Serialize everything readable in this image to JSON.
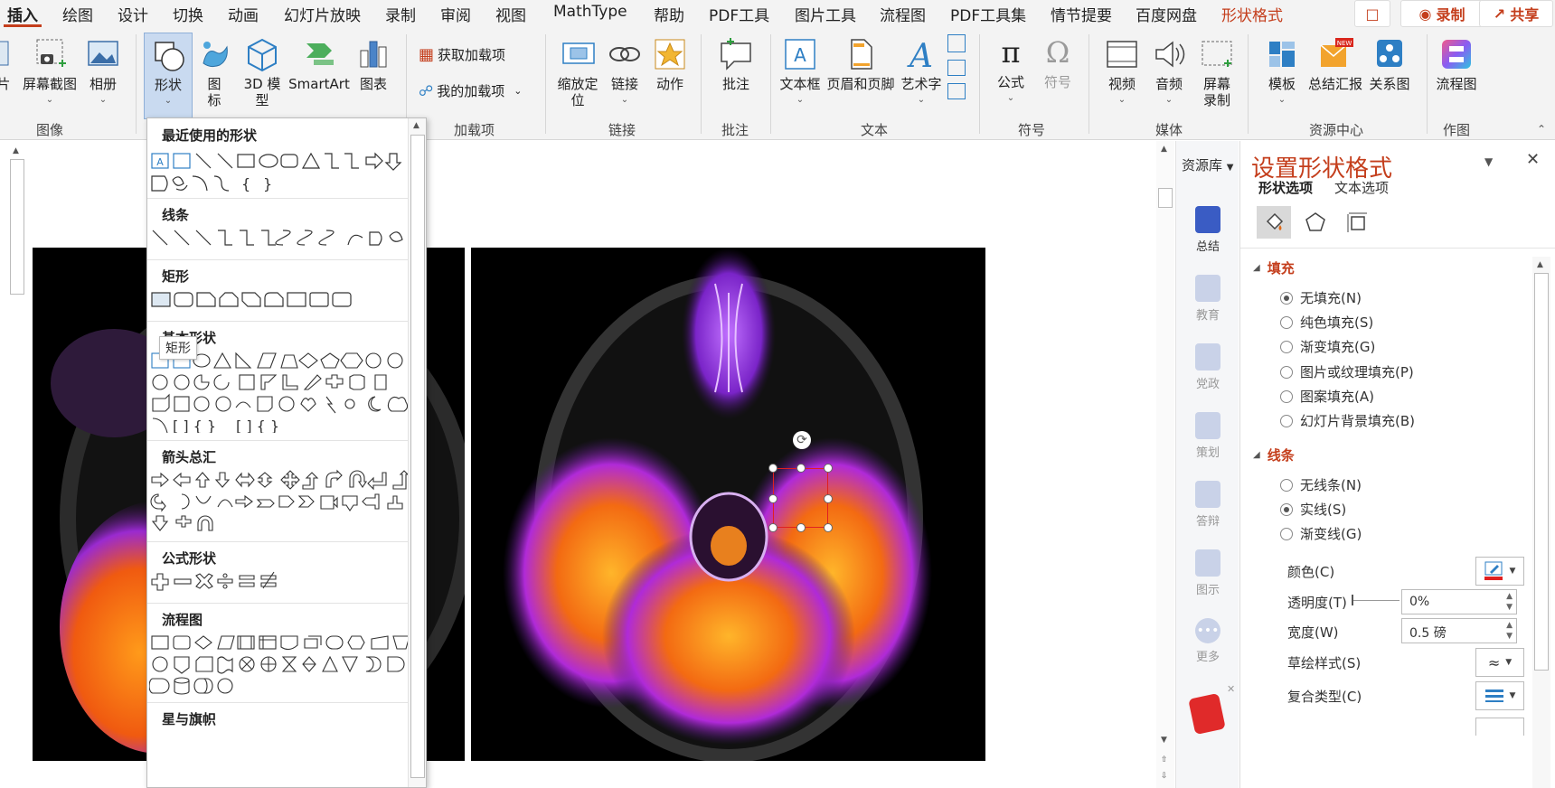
{
  "tabs": [
    "插入",
    "绘图",
    "设计",
    "切换",
    "动画",
    "幻灯片放映",
    "录制",
    "审阅",
    "视图",
    "MathType",
    "帮助",
    "PDF工具",
    "图片工具",
    "流程图",
    "PDF工具集",
    "情节提要",
    "百度网盘",
    "形状格式"
  ],
  "topbar": {
    "record_label": "录制",
    "share_label": "共享"
  },
  "ribbon": {
    "image_group": {
      "label": "图像",
      "screenshot": "屏幕截图",
      "album": "相册",
      "partial": "片"
    },
    "illus": {
      "shapes": "形状",
      "icons": "图标",
      "model3d": "3D 模型",
      "smartart": "SmartArt",
      "chart": "图表"
    },
    "addins": {
      "label": "加载项",
      "get": "获取加载项",
      "mine": "我的加载项"
    },
    "links": {
      "label": "链接",
      "zoom": "缩放定位",
      "link": "链接",
      "action": "动作"
    },
    "comments": {
      "label": "批注",
      "comment": "批注"
    },
    "text": {
      "label": "文本",
      "textbox": "文本框",
      "headerfooter": "页眉和页脚",
      "wordart": "艺术字"
    },
    "symbols": {
      "label": "符号",
      "equation": "公式",
      "symbol": "符号"
    },
    "media": {
      "label": "媒体",
      "video": "视频",
      "audio": "音频",
      "screenrec": "屏幕录制"
    },
    "resource": {
      "label": "资源中心",
      "template": "模板",
      "summary": "总结汇报",
      "relation": "关系图",
      "new_badge": "NEW"
    },
    "draw": {
      "label": "作图",
      "flowchart": "流程图"
    }
  },
  "shapes_menu": {
    "sections": [
      "最近使用的形状",
      "线条",
      "矩形",
      "基本形状",
      "箭头总汇",
      "公式形状",
      "流程图",
      "星与旗帜"
    ],
    "tooltip": "矩形"
  },
  "resbar": {
    "title": "资源库",
    "items": [
      "总结",
      "教育",
      "党政",
      "策划",
      "答辩",
      "图示",
      "更多"
    ]
  },
  "pane": {
    "title": "设置形状格式",
    "tab_shape": "形状选项",
    "tab_text": "文本选项",
    "fill": {
      "header": "填充",
      "options": [
        "无填充(N)",
        "纯色填充(S)",
        "渐变填充(G)",
        "图片或纹理填充(P)",
        "图案填充(A)",
        "幻灯片背景填充(B)"
      ],
      "selected": 0
    },
    "line": {
      "header": "线条",
      "options": [
        "无线条(N)",
        "实线(S)",
        "渐变线(G)"
      ],
      "selected": 1
    },
    "color_label": "颜色(C)",
    "transparency_label": "透明度(T)",
    "transparency_value": "0%",
    "width_label": "宽度(W)",
    "width_value": "0.5 磅",
    "sketch_label": "草绘样式(S)",
    "compound_label": "复合类型(C)"
  },
  "colors": {
    "accent": "#c43e1c",
    "selection": "#e02020"
  }
}
